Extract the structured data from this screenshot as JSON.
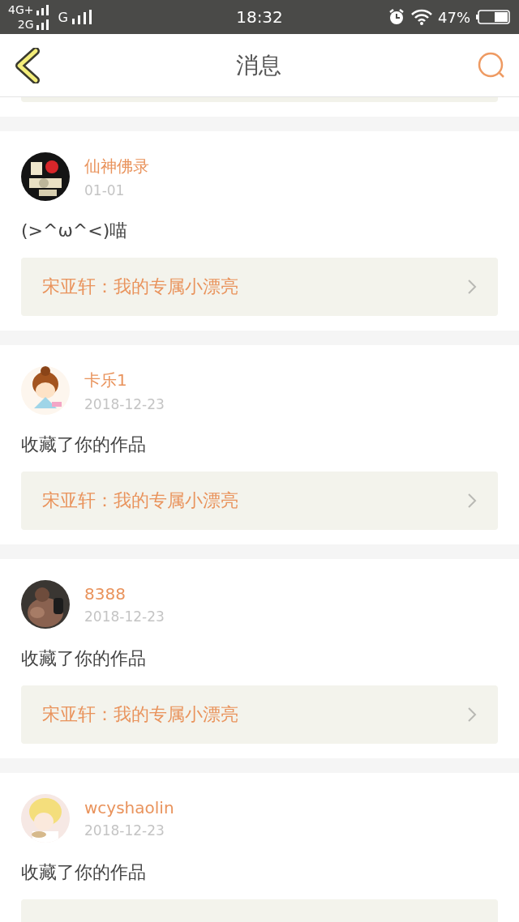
{
  "status_bar": {
    "network_1": "4G+",
    "network_2": "2G",
    "network_3": "G",
    "time": "18:32",
    "battery": "47%"
  },
  "header": {
    "title": "消息"
  },
  "messages": [
    {
      "user": "仙神佛录",
      "date": "01-01",
      "text": "(>^ω^<)喵",
      "ref": "宋亚轩：我的专属小漂亮"
    },
    {
      "user": "卡乐1",
      "date": "2018-12-23",
      "text": "收藏了你的作品",
      "ref": "宋亚轩：我的专属小漂亮"
    },
    {
      "user": "8388",
      "date": "2018-12-23",
      "text": "收藏了你的作品",
      "ref": "宋亚轩：我的专属小漂亮"
    },
    {
      "user": "wcyshaolin",
      "date": "2018-12-23",
      "text": "收藏了你的作品"
    }
  ]
}
